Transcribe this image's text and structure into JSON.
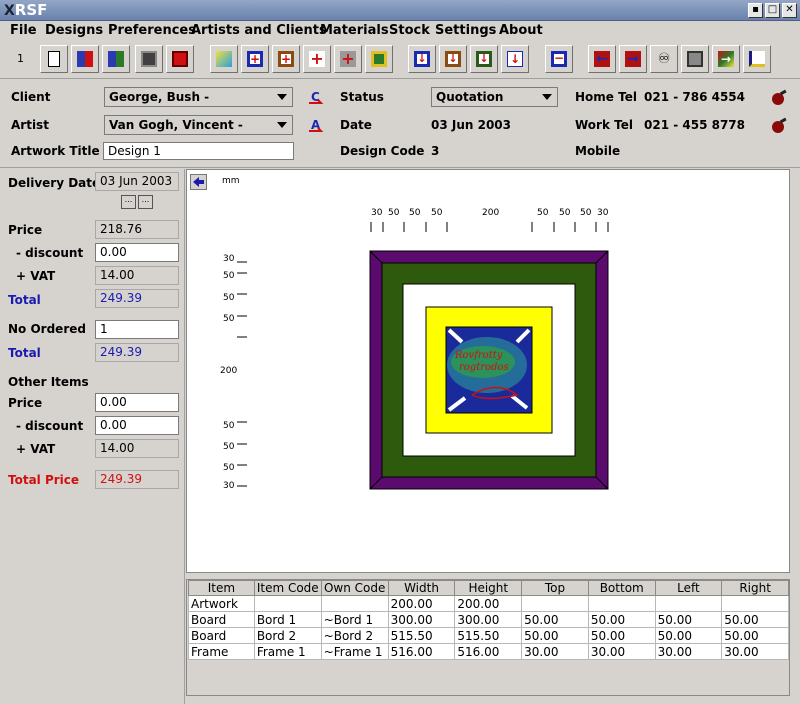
{
  "app": {
    "title": "RSF"
  },
  "menu": [
    "File",
    "Designs",
    "Preferences",
    "Artists and Clients",
    "Materials",
    "Stock",
    "Settings",
    "About"
  ],
  "toolbar": {
    "record_number": "1"
  },
  "header": {
    "client_label": "Client",
    "client_value": "George, Bush -",
    "artist_label": "Artist",
    "artist_value": "Van Gogh, Vincent -",
    "artwork_title_label": "Artwork Title",
    "artwork_title_value": "Design 1",
    "status_label": "Status",
    "status_value": "Quotation",
    "date_label": "Date",
    "date_value": "03 Jun 2003",
    "design_code_label": "Design Code",
    "design_code_value": "3",
    "home_tel_label": "Home Tel",
    "home_tel_value": "021 - 786 4554",
    "work_tel_label": "Work Tel",
    "work_tel_value": "021 - 455 8778",
    "mobile_label": "Mobile",
    "mobile_value": ""
  },
  "pricing": {
    "delivery_date_label": "Delivery Date",
    "delivery_date": "03 Jun 2003",
    "price_label": "Price",
    "price": "218.76",
    "discount_label": "- discount",
    "discount": "0.00",
    "vat_label": "+ VAT",
    "vat": "14.00",
    "total_label": "Total",
    "total": "249.39",
    "no_ordered_label": "No Ordered",
    "no_ordered": "1",
    "total2_label": "Total",
    "total2": "249.39",
    "other_items_label": "Other Items",
    "other_price_label": "Price",
    "other_price": "0.00",
    "other_discount_label": "- discount",
    "other_discount": "0.00",
    "other_vat_label": "+ VAT",
    "other_vat": "14.00",
    "total_price_label": "Total Price",
    "total_price": "249.39"
  },
  "drawing": {
    "unit": "mm",
    "top_ruler": [
      "30",
      "50",
      "50",
      "50",
      "200",
      "50",
      "50",
      "50",
      "30"
    ],
    "left_ruler": [
      "30",
      "50",
      "50",
      "50",
      "200",
      "50",
      "50",
      "50",
      "30"
    ],
    "artwork_text": "Rovfrotty\nrogtrodos",
    "colors": {
      "frame": "#5b0a6e",
      "board2": "#2e5a0e",
      "board1": "#ffffff",
      "inner": "#ffff00",
      "art_bg": "#1a2a9a"
    }
  },
  "table": {
    "columns": [
      "Item",
      "Item Code",
      "Own Code",
      "Width",
      "Height",
      "Top",
      "Bottom",
      "Left",
      "Right"
    ],
    "rows": [
      [
        "Artwork",
        "",
        "",
        "200.00",
        "200.00",
        "",
        "",
        "",
        ""
      ],
      [
        "Board",
        "Bord 1",
        "~Bord 1",
        "300.00",
        "300.00",
        "50.00",
        "50.00",
        "50.00",
        "50.00"
      ],
      [
        "Board",
        "Bord 2",
        "~Bord 2",
        "515.50",
        "515.50",
        "50.00",
        "50.00",
        "50.00",
        "50.00"
      ],
      [
        "Frame",
        "Frame 1",
        "~Frame 1",
        "516.00",
        "516.00",
        "30.00",
        "30.00",
        "30.00",
        "30.00"
      ]
    ]
  }
}
